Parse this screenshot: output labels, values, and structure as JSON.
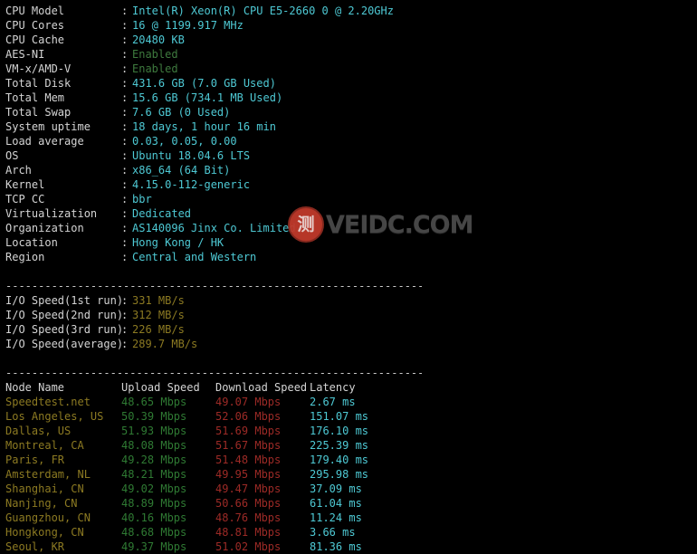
{
  "system_info": {
    "rows": [
      {
        "label": "CPU Model",
        "value": "Intel(R) Xeon(R) CPU E5-2660 0 @ 2.20GHz",
        "color": "cyan"
      },
      {
        "label": "CPU Cores",
        "value": "16 @ 1199.917 MHz",
        "color": "cyan"
      },
      {
        "label": "CPU Cache",
        "value": "20480 KB",
        "color": "cyan"
      },
      {
        "label": "AES-NI",
        "value": "Enabled",
        "color": "green"
      },
      {
        "label": "VM-x/AMD-V",
        "value": "Enabled",
        "color": "green"
      },
      {
        "label": "Total Disk",
        "value": "431.6 GB (7.0 GB Used)",
        "color": "cyan"
      },
      {
        "label": "Total Mem",
        "value": "15.6 GB (734.1 MB Used)",
        "color": "cyan"
      },
      {
        "label": "Total Swap",
        "value": "7.6 GB (0 Used)",
        "color": "cyan"
      },
      {
        "label": "System uptime",
        "value": "18 days, 1 hour 16 min",
        "color": "cyan"
      },
      {
        "label": "Load average",
        "value": "0.03, 0.05, 0.00",
        "color": "cyan"
      },
      {
        "label": "OS",
        "value": "Ubuntu 18.04.6 LTS",
        "color": "cyan"
      },
      {
        "label": "Arch",
        "value": "x86_64 (64 Bit)",
        "color": "cyan"
      },
      {
        "label": "Kernel",
        "value": "4.15.0-112-generic",
        "color": "cyan"
      },
      {
        "label": "TCP CC",
        "value": "bbr",
        "color": "cyan"
      },
      {
        "label": "Virtualization",
        "value": "Dedicated",
        "color": "cyan"
      },
      {
        "label": "Organization",
        "value": "AS140096 Jinx Co. Limited",
        "color": "cyan"
      },
      {
        "label": "Location",
        "value": "Hong Kong / HK",
        "color": "cyan"
      },
      {
        "label": "Region",
        "value": "Central and Western",
        "color": "cyan"
      }
    ],
    "separator": ":"
  },
  "divider": "----------------------------------------------------------------------",
  "io_speed": {
    "rows": [
      {
        "label": "I/O Speed(1st run)",
        "value": "331 MB/s"
      },
      {
        "label": "I/O Speed(2nd run)",
        "value": "312 MB/s"
      },
      {
        "label": "I/O Speed(3rd run)",
        "value": "226 MB/s"
      },
      {
        "label": "I/O Speed(average)",
        "value": "289.7 MB/s"
      }
    ]
  },
  "speedtest": {
    "headers": {
      "node": "Node Name",
      "upload": "Upload Speed",
      "download": "Download Speed",
      "latency": "Latency"
    },
    "rows": [
      {
        "node": "Speedtest.net",
        "upload": "48.65 Mbps",
        "download": "49.07 Mbps",
        "latency": "2.67 ms"
      },
      {
        "node": "Los Angeles, US",
        "upload": "50.39 Mbps",
        "download": "52.06 Mbps",
        "latency": "151.07 ms"
      },
      {
        "node": "Dallas, US",
        "upload": "51.93 Mbps",
        "download": "51.69 Mbps",
        "latency": "176.10 ms"
      },
      {
        "node": "Montreal, CA",
        "upload": "48.08 Mbps",
        "download": "51.67 Mbps",
        "latency": "225.39 ms"
      },
      {
        "node": "Paris, FR",
        "upload": "49.28 Mbps",
        "download": "51.48 Mbps",
        "latency": "179.40 ms"
      },
      {
        "node": "Amsterdam, NL",
        "upload": "48.21 Mbps",
        "download": "49.95 Mbps",
        "latency": "295.98 ms"
      },
      {
        "node": "Shanghai, CN",
        "upload": "49.02 Mbps",
        "download": "49.47 Mbps",
        "latency": "37.09 ms"
      },
      {
        "node": "Nanjing, CN",
        "upload": "48.89 Mbps",
        "download": "50.66 Mbps",
        "latency": "61.04 ms"
      },
      {
        "node": "Guangzhou, CN",
        "upload": "40.16 Mbps",
        "download": "48.76 Mbps",
        "latency": "11.24 ms"
      },
      {
        "node": "Hongkong, CN",
        "upload": "48.68 Mbps",
        "download": "48.81 Mbps",
        "latency": "3.66 ms"
      },
      {
        "node": "Seoul, KR",
        "upload": "49.37 Mbps",
        "download": "51.02 Mbps",
        "latency": "81.36 ms"
      }
    ]
  },
  "watermark": {
    "seal_char": "测",
    "text": "VEIDC.COM"
  },
  "colors": {
    "background": "#000000",
    "label": "#d4d4d4",
    "value_cyan": "#4ec9d4",
    "value_green": "#3e7a3e",
    "io_olive": "#8c7a22",
    "node_olive": "#8c7a22",
    "upload_green": "#2f7a33",
    "download_red": "#9c2a26",
    "latency_cyan": "#4ec9d4",
    "watermark_seal": "#c0392b",
    "watermark_text": "#4a4a4a"
  }
}
